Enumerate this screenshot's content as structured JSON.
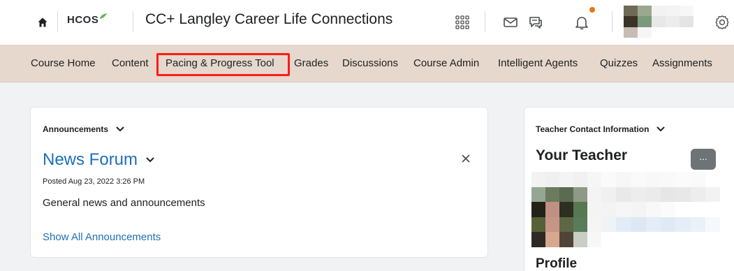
{
  "header": {
    "logo_text": "HCOS",
    "course_title": "CC+ Langley Career Life Connections",
    "icons": [
      "home-icon",
      "apps-grid-icon",
      "mail-icon",
      "chat-icon",
      "bell-icon",
      "gear-icon"
    ],
    "accent_color": "#e87511"
  },
  "navbar": {
    "items": [
      "Course Home",
      "Content",
      "Pacing & Progress Tool",
      "Grades",
      "Discussions",
      "Course Admin",
      "Intelligent Agents",
      "Quizzes",
      "Assignments"
    ],
    "highlighted_item": "Pacing & Progress Tool",
    "highlight_color": "#ff1a1a",
    "background_color": "#e6d8cd"
  },
  "announcements": {
    "widget_title": "Announcements",
    "item_title": "News Forum",
    "posted": "Posted Aug 23, 2022 3:26 PM",
    "body": "General news and announcements",
    "show_all_link": "Show All Announcements",
    "link_color": "#1e6fb5"
  },
  "teacher_contact": {
    "widget_title": "Teacher Contact Information",
    "heading": "Your Teacher",
    "more_button_label": "...",
    "profile_label": "Profile"
  }
}
